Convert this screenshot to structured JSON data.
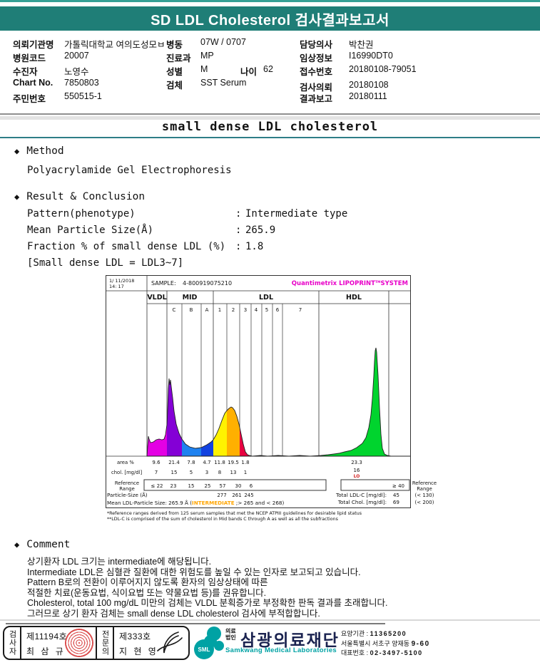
{
  "header": {
    "title": "SD LDL Cholesterol 검사결과보고서"
  },
  "patient": {
    "fields": [
      {
        "label": "의뢰기관명",
        "value": "가톨릭대학교 여의도성모ㅂ"
      },
      {
        "label": "병동",
        "value": "07W / 0707"
      },
      {
        "label": "담당의사",
        "value": "박찬권"
      },
      {
        "label": "병원코드",
        "value": "20007"
      },
      {
        "label": "진료과",
        "value": "MP"
      },
      {
        "label": "임상정보",
        "value": "I16990DT0"
      },
      {
        "label": "수진자",
        "value": "노영수"
      },
      {
        "label": "성별",
        "value": "M"
      },
      {
        "label": "나이",
        "value": "62"
      },
      {
        "label": "접수번호",
        "value": "20180108-79051"
      },
      {
        "label": "Chart No.",
        "value": "7850803"
      },
      {
        "label": "검체",
        "value": "SST Serum"
      },
      {
        "label": "검사의뢰",
        "value": "20180108"
      },
      {
        "label": "주민번호",
        "value": "550515-1"
      },
      {
        "label": "결과보고",
        "value": "20180111"
      }
    ]
  },
  "report": {
    "title": "small dense LDL cholesterol",
    "bullet": "◆",
    "method": {
      "heading": "Method",
      "value": "Polyacrylamide Gel Electrophoresis"
    }
  },
  "results": {
    "heading": "Result & Conclusion",
    "colon": ":",
    "rows": [
      {
        "label": "Pattern(phenotype)",
        "value": "Intermediate type"
      },
      {
        "label": "Mean Particle Size(Å)",
        "value": "265.9"
      },
      {
        "label": "Fraction % of small dense LDL (%)",
        "value": "1.8"
      }
    ],
    "note": "[Small dense LDL = LDL3~7]"
  },
  "chart_data": {
    "type": "area",
    "header": {
      "date": "1/ 11/2018",
      "time": "14: 17",
      "sample_label": "SAMPLE:",
      "sample_id": "4-800919075210",
      "system_name": "Quantimetrix LIPOPRINT",
      "system_tm": "TM",
      "system_suffix": "SYSTEM",
      "system_color": "#e800c8"
    },
    "group_labels": [
      "VLDL",
      "MID",
      "LDL",
      "HDL"
    ],
    "sub_labels": [
      "C",
      "B",
      "A",
      "1",
      "2",
      "3",
      "4",
      "5",
      "6",
      "7"
    ],
    "row_labels": {
      "area": "area %",
      "chol": "chol. [mg/dl]",
      "reference_1": "Reference",
      "reference_2": "Range",
      "particle": "Particle-Size (Å)"
    },
    "fractions": [
      {
        "band": "VLDL",
        "color": "#e400e4",
        "area_pct": "9.6",
        "chol": "7",
        "ref": "≤ 22"
      },
      {
        "band": "MID C",
        "color": "#8400d6",
        "area_pct": "21.4",
        "chol": "15",
        "ref": "23"
      },
      {
        "band": "MID B",
        "color": "#1e82f0",
        "area_pct": "7.8",
        "chol": "5",
        "ref": "15"
      },
      {
        "band": "MID A",
        "color": "#1242e0",
        "area_pct": "4.7",
        "chol": "3",
        "ref": "25"
      },
      {
        "band": "LDL 1",
        "color": "#fff200",
        "area_pct": "11.8",
        "chol": "8",
        "ref": "57",
        "particle_size": "277"
      },
      {
        "band": "LDL 2",
        "color": "#ffb000",
        "area_pct": "19.5",
        "chol": "13",
        "ref": "30",
        "particle_size": "261"
      },
      {
        "band": "LDL 3",
        "color": "#e80040",
        "area_pct": "1.8",
        "chol": "1",
        "ref": "6",
        "particle_size": "245"
      },
      {
        "band": "HDL",
        "color": "#00d42e",
        "area_pct": "23.3",
        "chol": "16",
        "chol_flag": "LO",
        "ref": "≥ 40"
      }
    ],
    "mean_line": {
      "prefix": "Mean LDL-Particle Size:  265.9 Å  (",
      "highlight": "INTERMEDIATE",
      "highlight_color": "#ffa500",
      "suffix": " ;> 265 and < 268)"
    },
    "totals": [
      {
        "label": "Total LDL-C [mg/dl]:",
        "value": "45",
        "ref": "(< 130)"
      },
      {
        "label": "Total Chol. [mg/dl]:",
        "value": "69",
        "ref": "(< 200)"
      }
    ],
    "lo_flag_color": "#d22222",
    "footnotes": [
      "*Reference ranges derived from 125 serum samples that met the NCEP ATPIII guidelines for desirable lipid status",
      "**LDL-C is comprised of the sum of cholesterol in Mid bands C through A as well as all the subfractions"
    ]
  },
  "comment": {
    "heading": "Comment",
    "lines": [
      "상기환자 LDL 크기는 intermediate에 해당됩니다.",
      "Intermediate LDL은 심혈관 질환에 대한 위험도를 높일 수 있는 인자로 보고되고 있습니다.",
      "Pattern B로의 전환이 이루어지지 않도록 환자의 임상상태에 따른",
      "적절한 치료(운동요법, 식이요법 또는 약물요법 등)를 권유합니다.",
      "Cholesterol, total 100 mg/dL 미만의 검체는 VLDL 분획증가로 부정확한 판독 결과를 초래합니다.",
      "그러므로 상기 환자 검체는 small dense LDL cholesterol 검사에 부적합합니다."
    ]
  },
  "footer": {
    "examiner": {
      "role": "검사자",
      "cert": "제11194호",
      "name": "최 삼 규"
    },
    "specialist": {
      "role": "전문의",
      "cert": "제333호",
      "name": "지 현 영"
    },
    "org": {
      "sml": "SML",
      "type1": "의료",
      "type2": "법인",
      "name": "삼광의료재단",
      "name_en": "Samkwang Medical Laboratories",
      "logo_color": "#00a2a4"
    },
    "contact": {
      "line1_label": "요양기관 :",
      "line1_value": "11365200",
      "line2": "서울특별시 서초구 양재동",
      "line2_bold": "9-60",
      "line3_label": "대표번호 :",
      "line3_value": "02-3497-5100"
    }
  }
}
